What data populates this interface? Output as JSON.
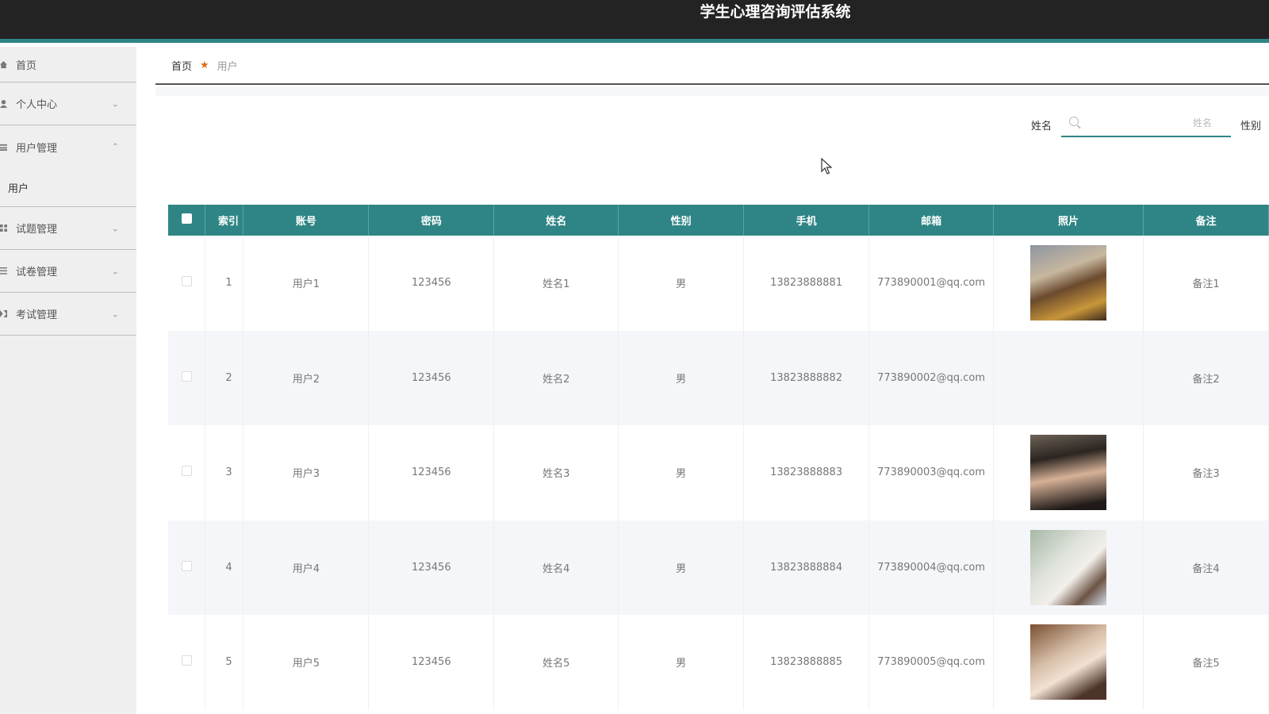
{
  "app_title": "学生心理咨询评估系统",
  "sidebar": {
    "items": [
      {
        "label": "首页",
        "icon": "home-icon",
        "expandable": false
      },
      {
        "label": "个人中心",
        "icon": "user-icon",
        "expandable": true,
        "expanded": false
      },
      {
        "label": "用户管理",
        "icon": "users-icon",
        "expandable": true,
        "expanded": true,
        "children": [
          "用户"
        ]
      },
      {
        "label": "试题管理",
        "icon": "grid-icon",
        "expandable": true,
        "expanded": false
      },
      {
        "label": "试卷管理",
        "icon": "list-icon",
        "expandable": true,
        "expanded": false
      },
      {
        "label": "考试管理",
        "icon": "exam-icon",
        "expandable": true,
        "expanded": false
      }
    ]
  },
  "breadcrumb": {
    "home": "首页",
    "current": "用户"
  },
  "search": {
    "label": "姓名",
    "placeholder": "姓名",
    "gender_label": "性别"
  },
  "table": {
    "columns": [
      "索引",
      "账号",
      "密码",
      "姓名",
      "性别",
      "手机",
      "邮箱",
      "照片",
      "备注"
    ],
    "rows": [
      {
        "index": "1",
        "account": "用户1",
        "password": "123456",
        "name": "姓名1",
        "gender": "男",
        "phone": "13823888881",
        "email": "773890001@qq.com",
        "photo": "p1",
        "remark": "备注1"
      },
      {
        "index": "2",
        "account": "用户2",
        "password": "123456",
        "name": "姓名2",
        "gender": "男",
        "phone": "13823888882",
        "email": "773890002@qq.com",
        "photo": "",
        "remark": "备注2"
      },
      {
        "index": "3",
        "account": "用户3",
        "password": "123456",
        "name": "姓名3",
        "gender": "男",
        "phone": "13823888883",
        "email": "773890003@qq.com",
        "photo": "p3",
        "remark": "备注3"
      },
      {
        "index": "4",
        "account": "用户4",
        "password": "123456",
        "name": "姓名4",
        "gender": "男",
        "phone": "13823888884",
        "email": "773890004@qq.com",
        "photo": "p4",
        "remark": "备注4"
      },
      {
        "index": "5",
        "account": "用户5",
        "password": "123456",
        "name": "姓名5",
        "gender": "男",
        "phone": "13823888885",
        "email": "773890005@qq.com",
        "photo": "p5",
        "remark": "备注5"
      }
    ]
  },
  "colors": {
    "header_bg": "#232323",
    "accent": "#2f8585",
    "breadcrumb_sep": "#e06a1c",
    "sidebar_bg": "#efefef",
    "row_alt": "#f4f6f9"
  }
}
